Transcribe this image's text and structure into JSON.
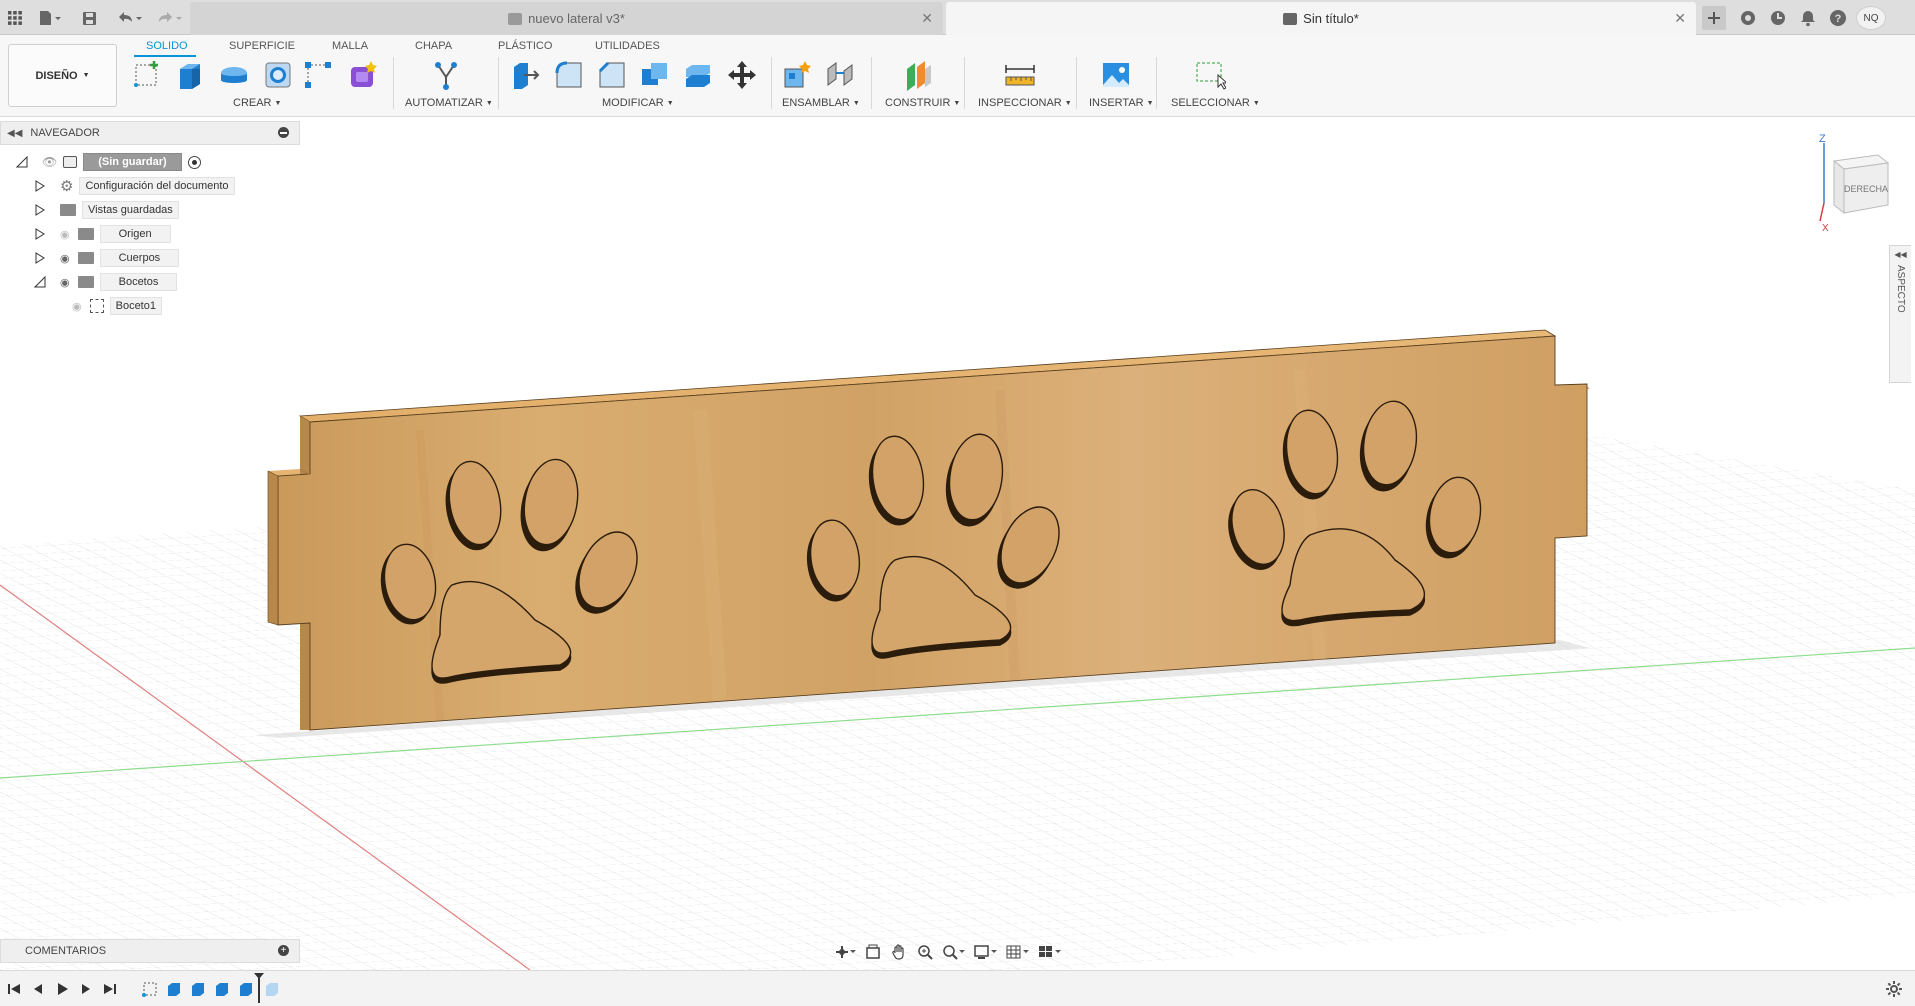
{
  "tabs": {
    "inactive_title": "nuevo lateral v3*",
    "active_title": "Sin título*"
  },
  "user": {
    "initials": "NQ"
  },
  "ribbon": {
    "workspace": "DISEÑO",
    "tabs": [
      "SOLIDO",
      "SUPERFICIE",
      "MALLA",
      "CHAPA",
      "PLÁSTICO",
      "UTILIDADES"
    ],
    "active_tab": "SOLIDO",
    "groups": {
      "create": "CREAR",
      "automate": "AUTOMATIZAR",
      "modify": "MODIFICAR",
      "assemble": "ENSAMBLAR",
      "construct": "CONSTRUIR",
      "inspect": "INSPECCIONAR",
      "insert": "INSERTAR",
      "select": "SELECCIONAR"
    }
  },
  "navigator": {
    "title": "NAVEGADOR",
    "root": "(Sin guardar)",
    "items": [
      {
        "label": "Configuración del documento",
        "icon": "gear-icon"
      },
      {
        "label": "Vistas guardadas",
        "icon": "folder-icon"
      },
      {
        "label": "Origen",
        "icon": "folder-icon"
      },
      {
        "label": "Cuerpos",
        "icon": "folder-icon"
      },
      {
        "label": "Bocetos",
        "icon": "folder-icon"
      },
      {
        "label": "Boceto1",
        "icon": "sketch-icon"
      }
    ]
  },
  "viewcube": {
    "face": "DERECHA",
    "axis_z": "Z",
    "axis_x": "X"
  },
  "aspect_panel": "ASPECTO",
  "comments": "COMENTARIOS",
  "colors": {
    "accent": "#0696d7",
    "wood": "#d4a466",
    "grid": "#c6c6c6"
  }
}
